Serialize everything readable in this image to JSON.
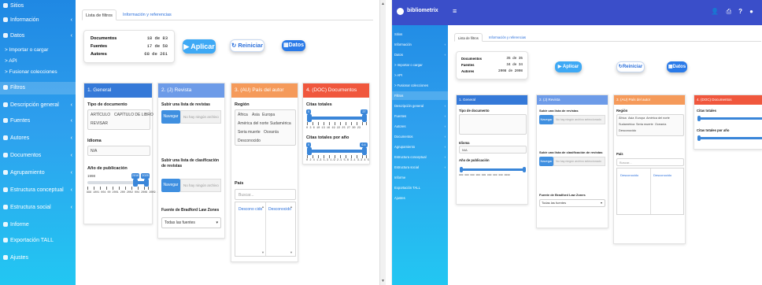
{
  "colors": {
    "sidebar_gradient_top": "#1f88e3",
    "sidebar_gradient_bottom": "#22c7f2",
    "topbar": "#3a4ec9",
    "card_general": "#3579d8",
    "card_revista": "#6d9be8",
    "card_pais": "#f59a5a",
    "card_doc": "#f0573d"
  },
  "left": {
    "sidebar": {
      "items": [
        {
          "label": "Sitios",
          "icon": "home-icon"
        },
        {
          "label": "Información",
          "icon": "info-icon"
        },
        {
          "label": "Datos",
          "icon": "database-icon"
        },
        {
          "label": "> Importar o cargar",
          "icon": ""
        },
        {
          "label": "> API",
          "icon": ""
        },
        {
          "label": "> Fusionar colecciones",
          "icon": ""
        },
        {
          "label": "Filtros",
          "icon": "filter-icon"
        },
        {
          "label": "Descripción general",
          "icon": "table-icon"
        },
        {
          "label": "Fuentes",
          "icon": "bars-icon"
        },
        {
          "label": "Autores",
          "icon": "user-icon"
        },
        {
          "label": "Documentos",
          "icon": "doc-icon"
        },
        {
          "label": "Agrupamiento",
          "icon": "cluster-icon"
        },
        {
          "label": "Estructura conceptual",
          "icon": "concept-icon"
        },
        {
          "label": "Estructura social",
          "icon": "social-icon"
        },
        {
          "label": "Informe",
          "icon": "report-icon"
        },
        {
          "label": "Exportación TALL",
          "icon": "export-icon"
        },
        {
          "label": "Ajustes",
          "icon": "settings-icon"
        }
      ]
    },
    "tabs": [
      "Lista de filtros",
      "Información y referencias"
    ],
    "summary": {
      "rows": [
        {
          "key": "Documentos",
          "value": "18 de 83"
        },
        {
          "key": "Fuentes",
          "value": "17 de 58"
        },
        {
          "key": "Autores",
          "value": "68 de 261"
        }
      ]
    },
    "buttons": {
      "apply": "Aplicar",
      "reset": "Reiniciar",
      "data": "Datos"
    },
    "cards": {
      "general": {
        "title": "1. General",
        "doc_type_label": "Tipo de documento",
        "doc_type_chips": [
          "ARTÍCULO",
          "CAPÍTULO DE LIBRO",
          "REVISAR"
        ],
        "language_label": "Idioma",
        "language_value": "N/A",
        "year_label": "Año de publicación",
        "year_min": "1998",
        "year_max": "2025",
        "year_badges": [
          "2016",
          "2025"
        ],
        "year_ticks": "998 1001 004 00 2001 200 2002 004 2006 2009 2003"
      },
      "revista": {
        "title": "2. (J) Revista",
        "upload_label": "Subir una lista de revistas",
        "upload_btn": "Navegar",
        "upload_placeholder": "No hay ningún archivo",
        "upload2_label": "Subir una lista de clasificación de revistas",
        "upload2_btn": "Navegar",
        "upload2_placeholder": "No hay ningún archivo",
        "bradford_label": "Fuente de Bradford Law Zones",
        "bradford_value": "Todas las fuentes"
      },
      "pais": {
        "title": "3. (AU) País del autor",
        "region_label": "Región",
        "region_chips": [
          "África",
          "Asia",
          "Europa",
          "América del norte",
          "Sudamérica",
          "Seria muerte",
          "Oceanía",
          "Desconocido"
        ],
        "country_label": "País",
        "search_placeholder": "Buscar...",
        "list_items": [
          "Descono cido",
          "Desconocido"
        ]
      },
      "doc": {
        "title": "4. (DOC) Documentos",
        "cites_label": "Citas totales",
        "cites_badges": [
          "0",
          "27"
        ],
        "cites_ticks": "0 3 6 10 13 16 19 22 25 27 30 23",
        "cites_year_label": "Citas totales por año",
        "cites_year_badges": [
          "0",
          "6.4"
        ],
        "cites_year_ticks": "0 2 4 1.3 1.3 1.9 2.1 5.8 3.1 3.3 4 5"
      }
    }
  },
  "right": {
    "app_title": "bibliometrix",
    "hamburger": "≡",
    "top_icons": [
      "user-icon",
      "share-icon",
      "help-icon",
      "chat-icon"
    ],
    "sidebar": {
      "items": [
        {
          "label": "Sitios"
        },
        {
          "label": "Información"
        },
        {
          "label": "Datos"
        },
        {
          "label": "> Importar o cargar"
        },
        {
          "label": "> API"
        },
        {
          "label": "> Fusionar colecciones"
        },
        {
          "label": "Filtros"
        },
        {
          "label": "Descripción general"
        },
        {
          "label": "Fuentes"
        },
        {
          "label": "Autores"
        },
        {
          "label": "Documentos"
        },
        {
          "label": "Agrupamiento"
        },
        {
          "label": "Estructura conceptual"
        },
        {
          "label": "Estructura social"
        },
        {
          "label": "Informe"
        },
        {
          "label": "Exportación TALL"
        },
        {
          "label": "Ajustes"
        }
      ]
    },
    "tabs": [
      "Lista de filtros",
      "Información y referencias"
    ],
    "summary": {
      "rows": [
        {
          "key": "Documentos",
          "value": "35 de 35"
        },
        {
          "key": "Fuentes",
          "value": "34 de 34"
        },
        {
          "key": "Autores",
          "value": "2008 de 2008"
        }
      ]
    },
    "buttons": {
      "apply": "Aplicar",
      "reset": "Reiniciar",
      "data": "Datos"
    },
    "cards": {
      "general": {
        "title": "1. General",
        "doc_type_label": "Tipo de documento",
        "language_label": "Idioma",
        "language_value": "N/A",
        "year_label": "Año de publicación",
        "year_ticks": "000 000 000 000 000 000 000 000 0000"
      },
      "revista": {
        "title": "2. (J) Revista",
        "upload_label": "Subir una lista de revistas",
        "upload_btn": "Navegar",
        "upload_placeholder": "No hay ningún archivo seleccionado",
        "upload2_label": "Subir una lista de clasificación de revistas",
        "upload2_btn": "Navegar",
        "upload2_placeholder": "No hay ningún archivo seleccionado",
        "bradford_label": "Fuente de Bradford Law Zones",
        "bradford_value": "Todas las fuentes"
      },
      "pais": {
        "title": "3. (AU) País del autor",
        "region_label": "Región",
        "region_chips": [
          "África",
          "Asia",
          "Europa",
          "América del norte",
          "Sudamérica",
          "Seria muerte",
          "Oceanía",
          "Desconocido"
        ],
        "country_label": "País",
        "search_placeholder": "Buscar...",
        "list_items": [
          "Desconocido",
          "Desconocido"
        ]
      },
      "doc": {
        "title": "4. (DOC) Documentos",
        "cites_label": "Citas totales",
        "cites_year_label": "Citas totales por año"
      }
    }
  }
}
